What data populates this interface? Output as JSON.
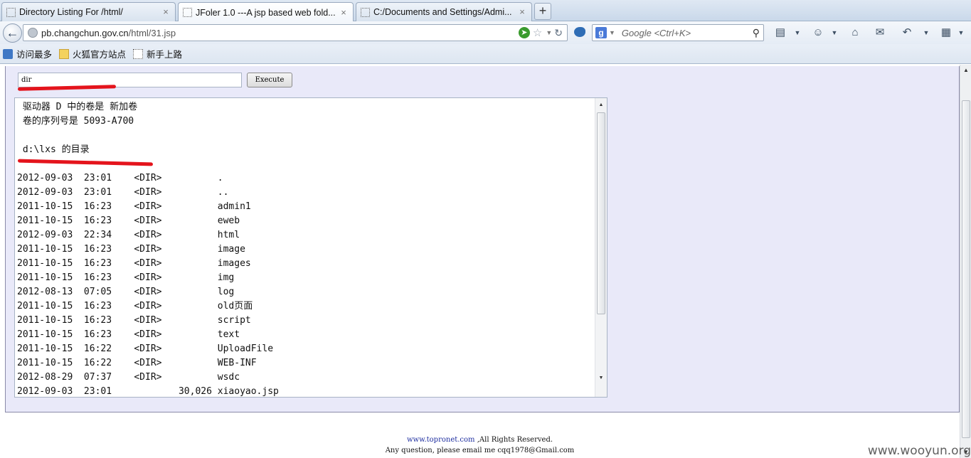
{
  "browser": {
    "tabs": [
      {
        "title": "Directory Listing For /html/",
        "active": false
      },
      {
        "title": "JFoler 1.0 ---A jsp based web fold...",
        "active": true
      },
      {
        "title": "C:/Documents and Settings/Admi...",
        "active": false
      }
    ],
    "new_tab_label": "+",
    "url_host": "pb.changchun.gov.cn",
    "url_path": "/html/31.jsp",
    "search_placeholder": "Google <Ctrl+K>",
    "bookmarks": [
      {
        "label": "访问最多",
        "icon": "recent-icon"
      },
      {
        "label": "火狐官方站点",
        "icon": "folder-icon"
      },
      {
        "label": "新手上路",
        "icon": "page-icon"
      }
    ]
  },
  "page": {
    "command_value": "dir",
    "execute_label": "Execute",
    "output_text": " 驱动器 D 中的卷是 新加卷\n 卷的序列号是 5093-A700\n\n d:\\lxs 的目录\n\n2012-09-03  23:01    <DIR>          .\n2012-09-03  23:01    <DIR>          ..\n2011-10-15  16:23    <DIR>          admin1\n2011-10-15  16:23    <DIR>          eweb\n2012-09-03  22:34    <DIR>          html\n2011-10-15  16:23    <DIR>          image\n2011-10-15  16:23    <DIR>          images\n2011-10-15  16:23    <DIR>          img\n2012-08-13  07:05    <DIR>          log\n2011-10-15  16:23    <DIR>          old页面\n2011-10-15  16:23    <DIR>          script\n2011-10-15  16:23    <DIR>          text\n2011-10-15  16:22    <DIR>          UploadFile\n2011-10-15  16:22    <DIR>          WEB-INF\n2012-08-29  07:37    <DIR>          wsdc\n2012-09-03  23:01            30,026 xiaoyao.jsp",
    "footer_link": "www.topronet.com",
    "footer_rights": " ,All Rights Reserved.",
    "footer_contact": "Any question, please email me cqq1978@Gmail.com"
  },
  "watermark": "www.wooyun.org",
  "colors": {
    "annotation_red": "#e4141c",
    "panel_bg": "#e9e9f9",
    "footer_link": "#1f2fa0"
  }
}
